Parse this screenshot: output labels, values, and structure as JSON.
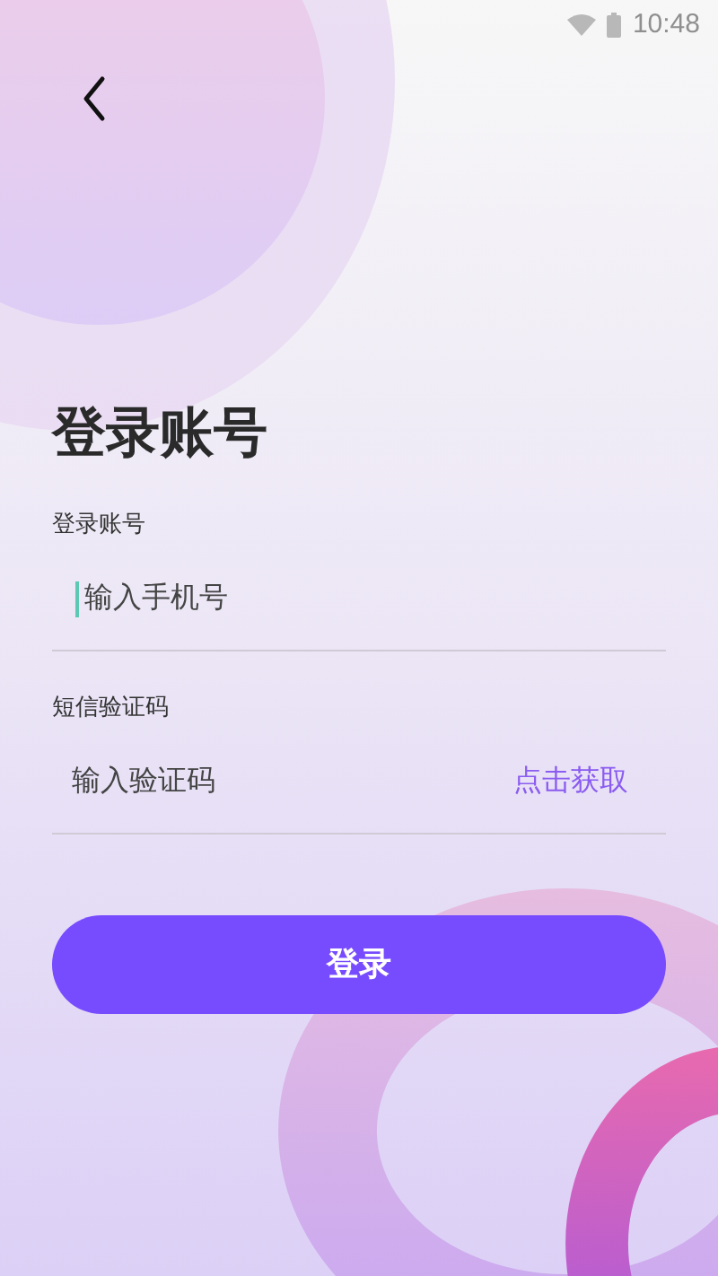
{
  "status_bar": {
    "time": "10:48"
  },
  "title": "登录账号",
  "fields": [
    {
      "label": "登录账号",
      "placeholder": "输入手机号",
      "focused": true
    },
    {
      "label": "短信验证码",
      "placeholder": "输入验证码",
      "focused": false,
      "action": "点击获取"
    }
  ],
  "submit": "登录"
}
